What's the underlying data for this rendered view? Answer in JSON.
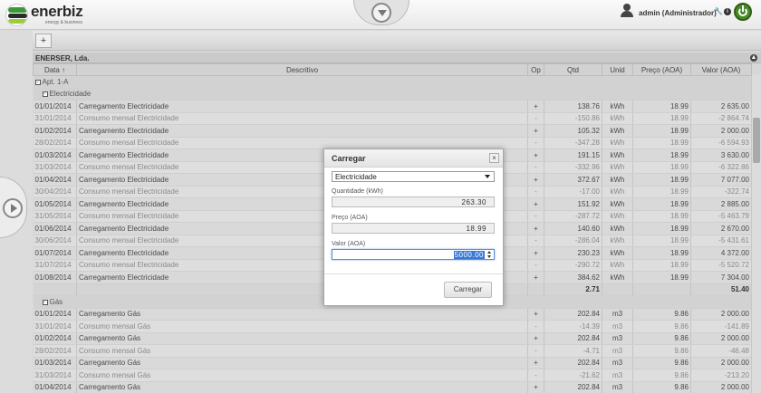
{
  "header": {
    "logo_text": "enerbiz",
    "logo_tagline": "energy & business",
    "user_label": "admin (Administrador)"
  },
  "toolbar": {
    "add_label": "+"
  },
  "grid": {
    "title": "ENERSER, Lda.",
    "columns": [
      "Data ↑",
      "Descritivo",
      "Op",
      "Qtd",
      "Unid",
      "Preço (AOA)",
      "Valor (AOA)"
    ],
    "group_apartment": "Apt. 1-A",
    "group_electricidade": "Electricidade",
    "group_gas": "Gás",
    "rows_electricidade": [
      [
        "01/01/2014",
        "Carregamento Electricidade",
        "+",
        "138.76",
        "kWh",
        "18.99",
        "2 635.00"
      ],
      [
        "31/01/2014",
        "Consumo mensal Electricidade",
        "-",
        "-150.86",
        "kWh",
        "18.99",
        "-2 864.74"
      ],
      [
        "01/02/2014",
        "Carregamento Electricidade",
        "+",
        "105.32",
        "kWh",
        "18.99",
        "2 000.00"
      ],
      [
        "28/02/2014",
        "Consumo mensal Electricidade",
        "-",
        "-347.28",
        "kWh",
        "18.99",
        "-6 594.93"
      ],
      [
        "01/03/2014",
        "Carregamento Electricidade",
        "+",
        "191.15",
        "kWh",
        "18.99",
        "3 630.00"
      ],
      [
        "31/03/2014",
        "Consumo mensal Electricidade",
        "-",
        "-332.96",
        "kWh",
        "18.99",
        "-6 322.86"
      ],
      [
        "01/04/2014",
        "Carregamento Electricidade",
        "+",
        "372.67",
        "kWh",
        "18.99",
        "7 077.00"
      ],
      [
        "30/04/2014",
        "Consumo mensal Electricidade",
        "-",
        "-17.00",
        "kWh",
        "18.99",
        "-322.74"
      ],
      [
        "01/05/2014",
        "Carregamento Electricidade",
        "+",
        "151.92",
        "kWh",
        "18.99",
        "2 885.00"
      ],
      [
        "31/05/2014",
        "Consumo mensal Electricidade",
        "-",
        "-287.72",
        "kWh",
        "18.99",
        "-5 463.79"
      ],
      [
        "01/06/2014",
        "Carregamento Electricidade",
        "+",
        "140.60",
        "kWh",
        "18.99",
        "2 670.00"
      ],
      [
        "30/06/2014",
        "Consumo mensal Electricidade",
        "-",
        "-286.04",
        "kWh",
        "18.99",
        "-5 431.61"
      ],
      [
        "01/07/2014",
        "Carregamento Electricidade",
        "+",
        "230.23",
        "kWh",
        "18.99",
        "4 372.00"
      ],
      [
        "31/07/2014",
        "Consumo mensal Electricidade",
        "-",
        "-290.72",
        "kWh",
        "18.99",
        "-5 520.72"
      ],
      [
        "01/08/2014",
        "Carregamento Electricidade",
        "+",
        "384.62",
        "kWh",
        "18.99",
        "7 304.00"
      ]
    ],
    "totals_electricidade": {
      "qtd": "2.71",
      "valor": "51.40"
    },
    "rows_gas": [
      [
        "01/01/2014",
        "Carregamento Gás",
        "+",
        "202.84",
        "m3",
        "9.86",
        "2 000.00"
      ],
      [
        "31/01/2014",
        "Consumo mensal Gás",
        "-",
        "-14.39",
        "m3",
        "9.86",
        "-141.89"
      ],
      [
        "01/02/2014",
        "Carregamento Gás",
        "+",
        "202.84",
        "m3",
        "9.86",
        "2 000.00"
      ],
      [
        "28/02/2014",
        "Consumo mensal Gás",
        "-",
        "-4.71",
        "m3",
        "9.86",
        "-46.48"
      ],
      [
        "01/03/2014",
        "Carregamento Gás",
        "+",
        "202.84",
        "m3",
        "9.86",
        "2 000.00"
      ],
      [
        "31/03/2014",
        "Consumo mensal Gás",
        "-",
        "-21.62",
        "m3",
        "9.86",
        "-213.20"
      ],
      [
        "01/04/2014",
        "Carregamento Gás",
        "+",
        "202.84",
        "m3",
        "9.86",
        "2 000.00"
      ]
    ]
  },
  "modal": {
    "title": "Carregar",
    "select_value": "Electricidade",
    "quantidade_label": "Quantidade (kWh)",
    "quantidade_value": "263.30",
    "preco_label": "Preço (AOA)",
    "preco_value": "18.99",
    "valor_label": "Valor (AOA)",
    "valor_value": "5000.00",
    "submit_label": "Carregar"
  }
}
